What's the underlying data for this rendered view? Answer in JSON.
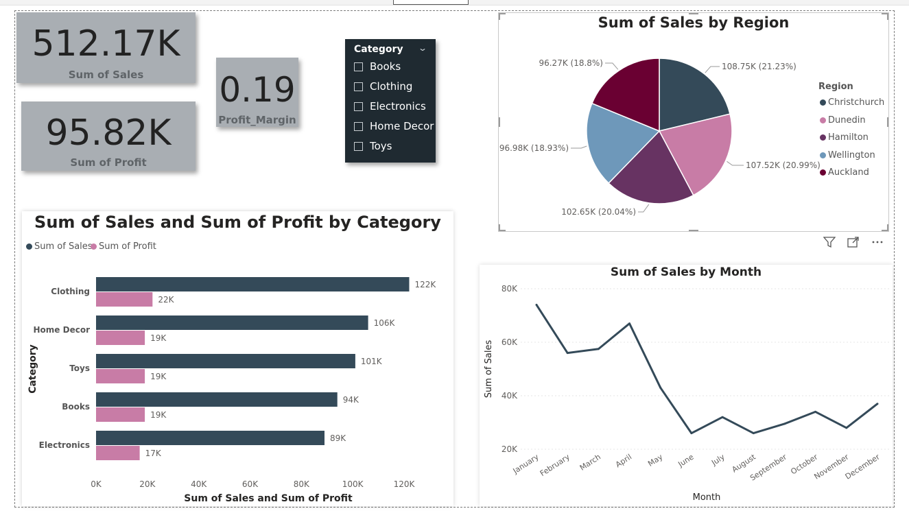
{
  "kpis": {
    "sales": {
      "value": "512.17K",
      "label": "Sum of Sales"
    },
    "profit": {
      "value": "95.82K",
      "label": "Sum of Profit"
    },
    "margin": {
      "value": "0.19",
      "label": "Profit_Margin"
    }
  },
  "slicer": {
    "title": "Category",
    "items": [
      "Books",
      "Clothing",
      "Electronics",
      "Home Decor",
      "Toys"
    ]
  },
  "pie": {
    "title": "Sum of Sales by Region",
    "legend_title": "Region",
    "legend": [
      "Christchurch",
      "Dunedin",
      "Hamilton",
      "Wellington",
      "Auckland"
    ],
    "colors": [
      "#344a59",
      "#c87ca6",
      "#673362",
      "#6e98ba",
      "#6a0032"
    ]
  },
  "bar": {
    "title": "Sum of Sales and Sum of Profit by Category",
    "legend": [
      "Sum of Sales",
      "Sum of Profit"
    ],
    "colors": [
      "#344a59",
      "#c87ca6"
    ],
    "xlabel": "Sum of Sales and Sum of Profit",
    "ylabel": "Category"
  },
  "line": {
    "title": "Sum of Sales by Month",
    "xlabel": "Month",
    "ylabel": "Sum of Sales",
    "color": "#344a59"
  },
  "header_icons": [
    "filter-icon",
    "focus-mode-icon",
    "more-options-icon"
  ],
  "chart_data": [
    {
      "type": "pie",
      "title": "Sum of Sales by Region",
      "categories": [
        "Christchurch",
        "Dunedin",
        "Hamilton",
        "Wellington",
        "Auckland"
      ],
      "values": [
        108.75,
        107.52,
        102.65,
        96.98,
        96.27
      ],
      "labels": [
        "108.75K (21.23%)",
        "107.52K (20.99%)",
        "102.65K (20.04%)",
        "96.98K (18.93%)",
        "96.27K (18.8%)"
      ],
      "legend_position": "right"
    },
    {
      "type": "bar",
      "orientation": "horizontal",
      "title": "Sum of Sales and Sum of Profit by Category",
      "categories": [
        "Clothing",
        "Home Decor",
        "Toys",
        "Books",
        "Electronics"
      ],
      "series": [
        {
          "name": "Sum of Sales",
          "values": [
            122,
            106,
            101,
            94,
            89
          ],
          "labels": [
            "122K",
            "106K",
            "101K",
            "94K",
            "89K"
          ]
        },
        {
          "name": "Sum of Profit",
          "values": [
            22,
            19,
            19,
            19,
            17
          ],
          "labels": [
            "22K",
            "19K",
            "19K",
            "19K",
            "17K"
          ]
        }
      ],
      "xticks": [
        "0K",
        "20K",
        "40K",
        "60K",
        "80K",
        "100K",
        "120K"
      ],
      "xlim": [
        0,
        120
      ],
      "xlabel": "Sum of Sales and Sum of Profit",
      "ylabel": "Category",
      "legend_position": "top-left"
    },
    {
      "type": "line",
      "title": "Sum of Sales by Month",
      "categories": [
        "January",
        "February",
        "March",
        "April",
        "May",
        "June",
        "July",
        "August",
        "September",
        "October",
        "November",
        "December"
      ],
      "values": [
        74,
        56,
        57.5,
        67,
        43,
        26,
        32,
        26,
        29.5,
        34,
        28,
        37
      ],
      "yticks": [
        "20K",
        "40K",
        "60K",
        "80K"
      ],
      "ylim": [
        20,
        80
      ],
      "xlabel": "Month",
      "ylabel": "Sum of Sales",
      "grid": true
    }
  ]
}
